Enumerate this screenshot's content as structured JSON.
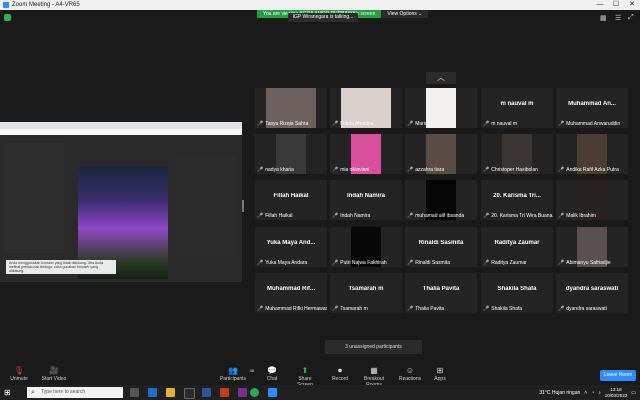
{
  "window": {
    "title": "Zoom Meeting - A4-VR65",
    "min": "—",
    "max": "☐",
    "close": "✕"
  },
  "banner": {
    "message": "You are viewing AGRA AMOR PURBAWA's screen",
    "options": "View Options ⌄"
  },
  "talking": "IGP Wiranegara is talking...",
  "share": {
    "toast": "Anda menggunakan browser yang tidak didukung. Jika Anda melihat perilaku tak terduga, coba gunakan browser yang didukung."
  },
  "participants": [
    {
      "name": "Tasya Rizqia Sahra",
      "label": "Tasya Rizqia Sahra",
      "video": "#6f6060",
      "vw": 50
    },
    {
      "name": "Fidela Amodya",
      "label": "Fidela Amodya",
      "video": "#d9d0cc",
      "vw": 50
    },
    {
      "name": "Maria",
      "label": "Maria ...",
      "video": "#f2f0ee",
      "vw": 30
    },
    {
      "name": "m nauval m",
      "label": "m nauval m",
      "video": "",
      "vw": 0
    },
    {
      "name": "Muhammad An...",
      "label": "Muhammad Anwaruddin",
      "video": "",
      "vw": 0
    },
    {
      "name": "nadya kharia",
      "label": "nadya kharia",
      "video": "#3b3a3a",
      "vw": 30
    },
    {
      "name": "mia oktaviani",
      "label": "mia oktaviani",
      "video": "#d94f9c",
      "vw": 30
    },
    {
      "name": "azzahra tiara",
      "label": "azzahra tiara",
      "video": "#5b4b45",
      "vw": 30
    },
    {
      "name": "Christoper Hasibolan",
      "label": "Christoper Hasibolan",
      "video": "#3a3532",
      "vw": 30
    },
    {
      "name": "Andika Rafif Azka Putra",
      "label": "Andika Rafif Azka Putra",
      "video": "#4b3d34",
      "vw": 30
    },
    {
      "name": "Fillah Haikal",
      "label": "Fillah Haikal",
      "video": "",
      "vw": 0
    },
    {
      "name": "Indah Namira",
      "label": "Indah Namira",
      "video": "",
      "vw": 0
    },
    {
      "name": "muhamad alif ibsanda",
      "label": "muhamad alif ibsanda",
      "video": "#050505",
      "vw": 30
    },
    {
      "name": "20. Karisma Tri...",
      "label": "20. Karisma Tri Wira Buana...",
      "video": "",
      "vw": 0
    },
    {
      "name": "Malik Ibrahim",
      "label": "Malik Ibrahim",
      "video": "#2a2222",
      "vw": 30
    },
    {
      "name": "Yuka Maya And...",
      "label": "Yuka Maya Andara",
      "video": "",
      "vw": 0
    },
    {
      "name": "Putri Najwa Fakhirah",
      "label": "Putri Najwa Fakhirah",
      "video": "#080808",
      "vw": 30
    },
    {
      "name": "Rinaldi Sasmita",
      "label": "Rinaldi Sasmita",
      "video": "",
      "vw": 0
    },
    {
      "name": "Raditya Zaumar",
      "label": "Raditya Zaumar",
      "video": "",
      "vw": 0
    },
    {
      "name": "Abimanyu Safriadjie",
      "label": "Abimanyu Safriadjie",
      "video": "#5a5050",
      "vw": 30
    },
    {
      "name": "Muhammad Rif...",
      "label": "Muhammad Rifki Hermawan",
      "video": "",
      "vw": 0
    },
    {
      "name": "Tsamarah m",
      "label": "Tsamarah m",
      "video": "",
      "vw": 0
    },
    {
      "name": "Thalia Pavita",
      "label": "Thalia Pavita",
      "video": "",
      "vw": 0
    },
    {
      "name": "Shakila Shafa",
      "label": "Shakila Shafa",
      "video": "",
      "vw": 0
    },
    {
      "name": "dyandra saraswati",
      "label": "dyandra saraswati",
      "video": "",
      "vw": 0
    }
  ],
  "unassigned": "3 unassigned participants",
  "toolbar": {
    "unmute": "Unmute",
    "start_video": "Start Video",
    "participants": "Participants",
    "participants_count": "38",
    "chat": "Chat",
    "share_screen": "Share Screen",
    "record": "Record",
    "breakout": "Breakout Rooms",
    "reactions": "Reactions",
    "apps": "Apps",
    "leave": "Leave Room"
  },
  "taskbar": {
    "search_placeholder": "Type here to search",
    "weather": "31°C Hujan ringan",
    "time": "13:18",
    "date": "10/03/2022"
  }
}
